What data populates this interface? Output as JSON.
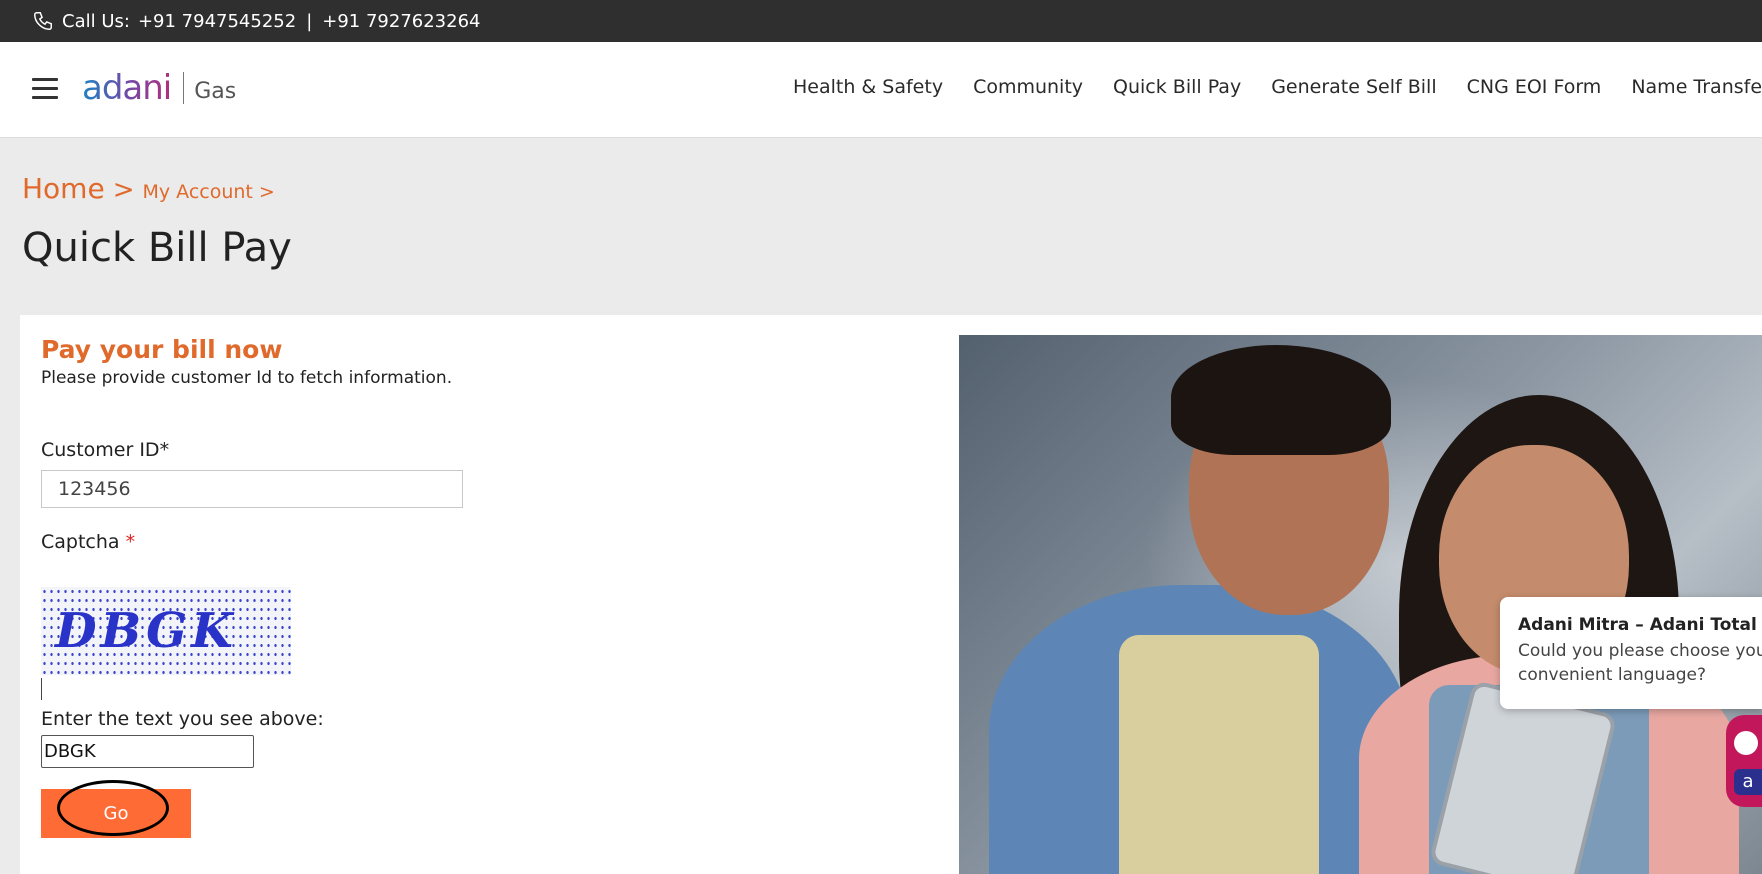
{
  "topbar": {
    "call_label": "Call Us:",
    "phone1": "+91 7947545252",
    "separator": "|",
    "phone2": "+91 7927623264"
  },
  "header": {
    "logo_word": "adani",
    "logo_sub": "Gas",
    "nav": [
      "Health & Safety",
      "Community",
      "Quick Bill Pay",
      "Generate Self Bill",
      "CNG EOI Form",
      "Name Transfe"
    ]
  },
  "breadcrumb": {
    "home": "Home",
    "chevron": ">",
    "account": "My Account",
    "chevron2": ">"
  },
  "page": {
    "title": "Quick Bill Pay"
  },
  "form": {
    "heading": "Pay your bill now",
    "subtext": "Please provide customer Id to fetch information.",
    "customer_label": "Customer ID*",
    "customer_value": "123456",
    "captcha_label": "Captcha",
    "required_mark": "*",
    "captcha_text": "DBGK",
    "enter_label": "Enter the text you see above:",
    "captcha_input_value": "DBGK",
    "go_label": "Go"
  },
  "chat": {
    "title": "Adani Mitra – Adani Total Ga",
    "message_line1": "Could you please choose your",
    "message_line2": "convenient language?",
    "bot_letter": "a"
  },
  "colors": {
    "accent": "#e06a2c",
    "button": "#ff6b35",
    "topbar": "#2f2f2f"
  }
}
